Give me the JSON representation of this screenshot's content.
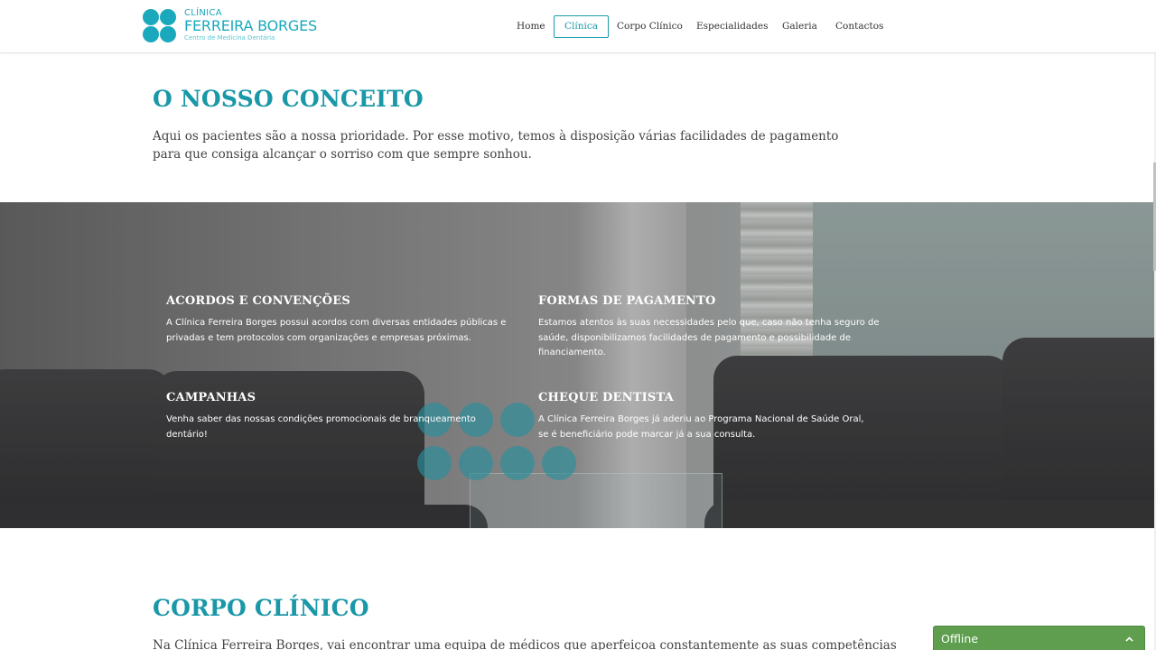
{
  "header": {
    "logo": {
      "small": "CLÍNICA",
      "big": "FERREIRA BORGES",
      "sub": "Centro de Medicina Dentária"
    },
    "nav": [
      {
        "label": "Home",
        "active": false
      },
      {
        "label": "Clínica",
        "active": true
      },
      {
        "label": "Corpo Clínico",
        "active": false
      },
      {
        "label": "Especialidades",
        "active": false
      },
      {
        "label": "Galeria",
        "active": false
      },
      {
        "label": "Contactos",
        "active": false
      }
    ]
  },
  "concept": {
    "title": "O NOSSO CONCEITO",
    "text": "Aqui os pacientes são a nossa prioridade. Por esse motivo, temos à disposição várias facilidades de pagamento para que consiga alcançar o sorriso com que sempre sonhou."
  },
  "features": [
    {
      "title": "ACORDOS E CONVENÇÕES",
      "text": "A Clínica Ferreira Borges possui acordos com diversas entidades públicas e privadas e tem protocolos com organizações e empresas próximas."
    },
    {
      "title": "FORMAS DE PAGAMENTO",
      "text": "Estamos atentos às suas necessidades pelo que, caso não tenha seguro de saúde, disponibilizamos facilidades de pagamento e possibilidade de financiamento."
    },
    {
      "title": "CAMPANHAS",
      "text": "Venha saber das nossas condições promocionais de branqueamento dentário!"
    },
    {
      "title": "CHEQUE DENTISTA",
      "text": "A Clínica Ferreira Borges já aderiu ao Programa Nacional de Saúde Oral, se é beneficiário pode marcar já a sua consulta."
    }
  ],
  "corpo": {
    "title": "CORPO CLÍNICO",
    "text": "Na Clínica Ferreira Borges, vai encontrar uma equipa de médicos que aperfeiçoa constantemente as suas competências"
  },
  "chat": {
    "status": "Offline",
    "chevron_icon": "chevron-up-icon",
    "color": "#5e9e4e"
  },
  "colors": {
    "accent": "#1a98a8"
  }
}
